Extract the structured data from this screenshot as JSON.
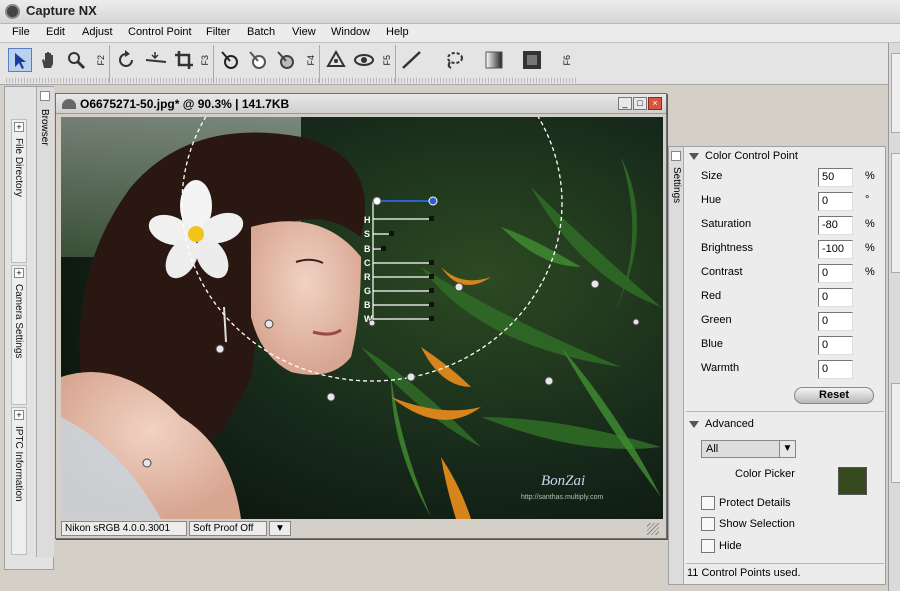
{
  "app": {
    "title": "Capture NX"
  },
  "menu": [
    "File",
    "Edit",
    "Adjust",
    "Control Point",
    "Filter",
    "Batch",
    "View",
    "Window",
    "Help"
  ],
  "toolbar": {
    "fkeys": [
      "F2",
      "F3",
      "F4",
      "F5",
      "F6"
    ],
    "tools": [
      "direct-select-icon",
      "hand-icon",
      "zoom-icon",
      "rotate-icon",
      "straighten-icon",
      "crop-icon",
      "black-point-icon",
      "white-point-icon",
      "neutral-point-icon",
      "red-eye-icon",
      "color-control-point-icon",
      "line-tool-icon",
      "lasso-icon",
      "gradient-icon",
      "fill-icon"
    ]
  },
  "left_panel": {
    "browser_label": "Browser",
    "tabs": [
      "File Directory",
      "Camera Settings",
      "IPTC Information"
    ]
  },
  "image_window": {
    "title": "O6675271-50.jpg* @ 90.3% | 141.7KB",
    "status_profile": "Nikon sRGB 4.0.0.3001",
    "status_proof": "Soft Proof Off",
    "watermark_name": "BonZai",
    "watermark_url": "http://santhas.multiply.com",
    "slider_letters": [
      "H",
      "S",
      "B",
      "C",
      "R",
      "G",
      "B",
      "W"
    ]
  },
  "settings": {
    "tab_label": "Settings",
    "section_title": "Color Control Point",
    "params": [
      {
        "label": "Size",
        "value": "50",
        "unit": "%"
      },
      {
        "label": "Hue",
        "value": "0",
        "unit": "°"
      },
      {
        "label": "Saturation",
        "value": "-80",
        "unit": "%"
      },
      {
        "label": "Brightness",
        "value": "-100",
        "unit": "%"
      },
      {
        "label": "Contrast",
        "value": "0",
        "unit": "%"
      },
      {
        "label": "Red",
        "value": "0",
        "unit": ""
      },
      {
        "label": "Green",
        "value": "0",
        "unit": ""
      },
      {
        "label": "Blue",
        "value": "0",
        "unit": ""
      },
      {
        "label": "Warmth",
        "value": "0",
        "unit": ""
      }
    ],
    "reset_label": "Reset",
    "advanced_title": "Advanced",
    "advanced_select": "All",
    "color_picker_label": "Color Picker",
    "color_picker_value": "#374a1f",
    "checkboxes": [
      "Protect Details",
      "Show Selection",
      "Hide"
    ],
    "status": "11 Control Points used."
  },
  "colors": {
    "accent": "#2e5fd0",
    "panel": "#ececec"
  }
}
